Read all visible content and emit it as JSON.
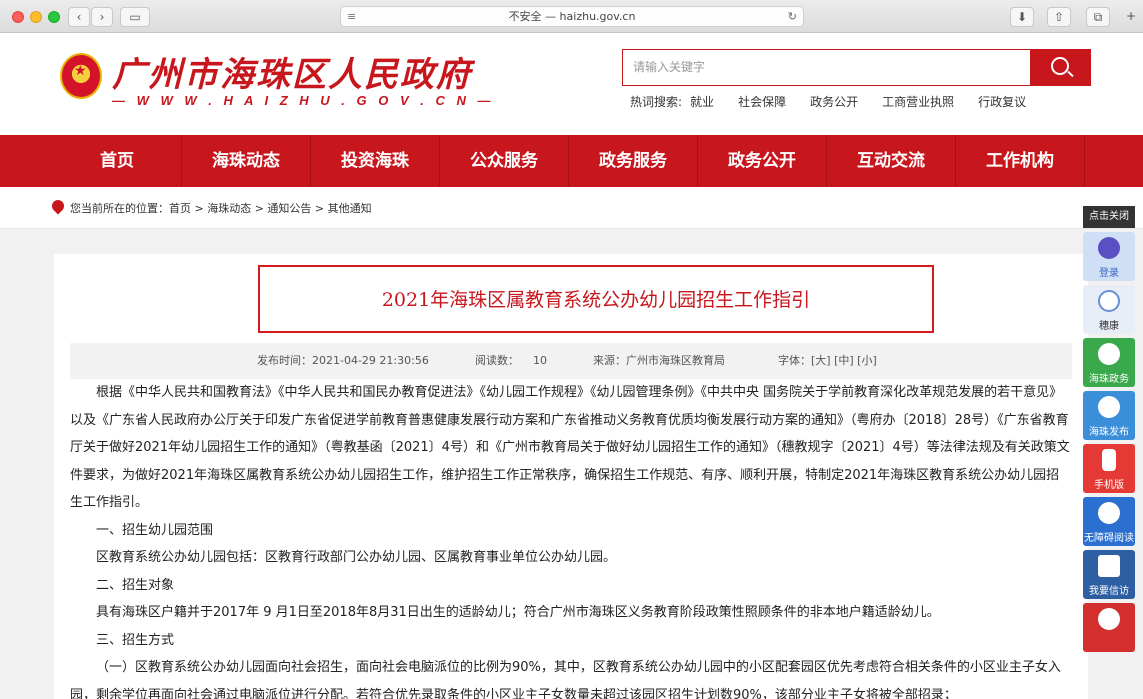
{
  "browser": {
    "address": "不安全 — haizhu.gov.cn"
  },
  "header": {
    "site_title": "广州市海珠区人民政府",
    "site_url": "— W W W . H A I Z H U . G O V . C N —",
    "search_placeholder": "请输入关键字",
    "hot_label": "热词搜索:",
    "hot_words": [
      "就业",
      "社会保障",
      "政务公开",
      "工商营业执照",
      "行政复议"
    ]
  },
  "nav": {
    "items": [
      "首页",
      "海珠动态",
      "投资海珠",
      "公众服务",
      "政务服务",
      "政务公开",
      "互动交流",
      "工作机构"
    ]
  },
  "breadcrumb": "您当前所在的位置：首页 > 海珠动态 > 通知公告 > 其他通知",
  "article": {
    "title": "2021年海珠区属教育系统公办幼儿园招生工作指引",
    "publish_time": "发布时间：2021-04-29 21:30:56",
    "read_count": "阅读数：    10",
    "source": "来源：广州市海珠区教育局",
    "font_size": "字体：[大] [中] [小]",
    "paragraphs": [
      "根据《中华人民共和国教育法》《中华人民共和国民办教育促进法》《幼儿园工作规程》《幼儿园管理条例》《中共中央 国务院关于学前教育深化改革规范发展的若干意见》以及《广东省人民政府办公厅关于印发广东省促进学前教育普惠健康发展行动方案和广东省推动义务教育优质均衡发展行动方案的通知》（粤府办〔2018〕28号）《广东省教育厅关于做好2021年幼儿园招生工作的通知》（粤教基函〔2021〕4号）和《广州市教育局关于做好幼儿园招生工作的通知》（穗教规字〔2021〕4号）等法律法规及有关政策文件要求，为做好2021年海珠区属教育系统公办幼儿园招生工作，维护招生工作正常秩序，确保招生工作规范、有序、顺利开展，特制定2021年海珠区教育系统公办幼儿园招生工作指引。",
      "一、招生幼儿园范围",
      "区教育系统公办幼儿园包括：区教育行政部门公办幼儿园、区属教育事业单位公办幼儿园。",
      "二、招生对象",
      "具有海珠区户籍并于2017年 9 月1日至2018年8月31日出生的适龄幼儿；符合广州市海珠区义务教育阶段政策性照顾条件的非本地户籍适龄幼儿。",
      "三、招生方式",
      "（一）区教育系统公办幼儿园面向社会招生，面向社会电脑派位的比例为90%，其中，区教育系统公办幼儿园中的小区配套园区优先考虑符合相关条件的小区业主子女入园，剩余学位再面向社会通过电脑派位进行分配。若符合优先录取条件的小区业主子女数量未超过该园区招生计划数90%，该部分业主子女将被全部招录；"
    ]
  },
  "float_panel": {
    "close": "点击关闭",
    "items": [
      "登录",
      "穗康",
      "海珠政务",
      "海珠发布",
      "手机版",
      "无障碍阅读",
      "我要信访",
      ""
    ]
  }
}
